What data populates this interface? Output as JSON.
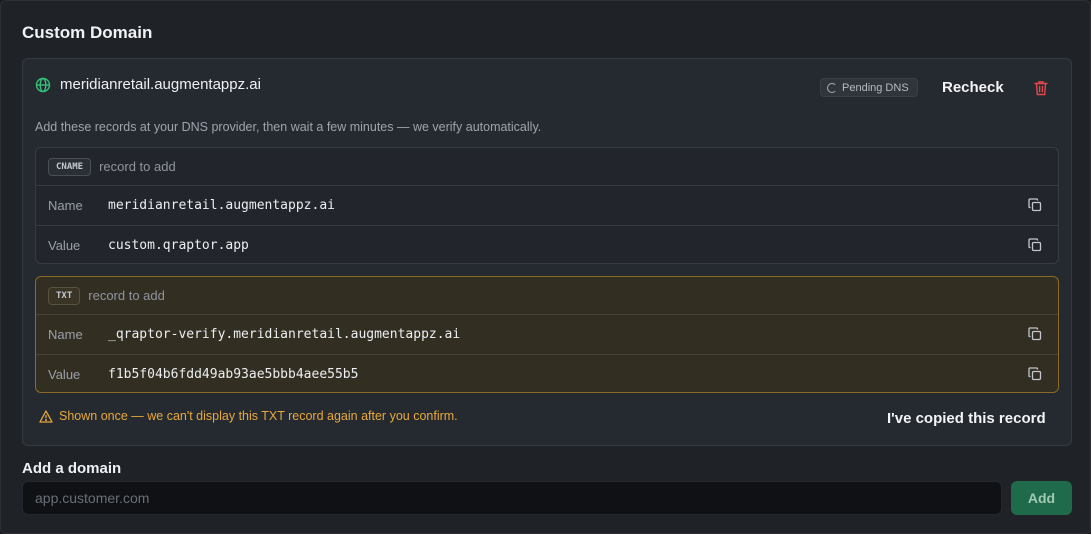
{
  "section": {
    "title": "Custom Domain"
  },
  "domain": {
    "name": "meridianretail.augmentappz.ai",
    "status": "Pending DNS",
    "recheck_label": "Recheck",
    "instructions": "Add these records at your DNS provider, then wait a few minutes — we verify automatically."
  },
  "cname_record": {
    "type": "CNAME",
    "subtitle": "record to add",
    "name_label": "Name",
    "name_value": "meridianretail.augmentappz.ai",
    "value_label": "Value",
    "value_value": "custom.qraptor.app"
  },
  "txt_record": {
    "type": "TXT",
    "subtitle": "record to add",
    "name_label": "Name",
    "name_value": "_qraptor-verify.meridianretail.augmentappz.ai",
    "value_label": "Value",
    "value_value": "f1b5f04b6fdd49ab93ae5bbb4aee55b5"
  },
  "warning": {
    "text": "Shown once — we can't display this TXT record again after you confirm.",
    "confirm_label": "I've copied this record"
  },
  "add_domain": {
    "label": "Add a domain",
    "placeholder": "app.customer.com",
    "value": "",
    "button_label": "Add"
  },
  "colors": {
    "accent_green": "#1f6a4a",
    "globe_green": "#34c17a",
    "danger_red": "#e5484d",
    "warning_amber": "#e8a93a"
  },
  "icons": [
    "globe-icon",
    "spinner-icon",
    "trash-icon",
    "copy-icon",
    "warning-icon"
  ]
}
